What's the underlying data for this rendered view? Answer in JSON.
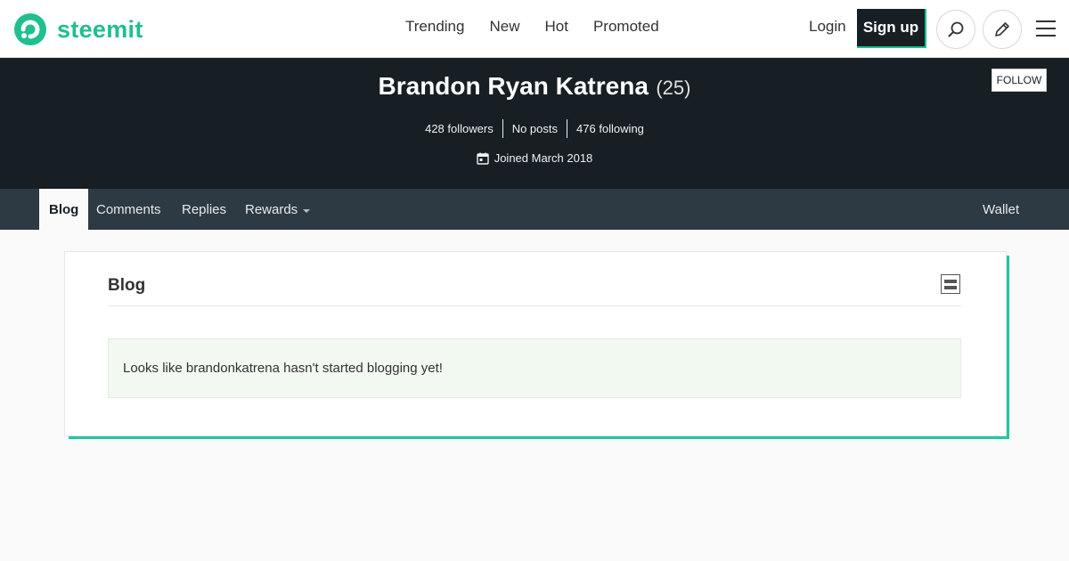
{
  "header": {
    "logo_text": "steemit",
    "nav": [
      "Trending",
      "New",
      "Hot",
      "Promoted"
    ],
    "login_label": "Login",
    "signup_label": "Sign up",
    "brand_color": "#1fbf8f"
  },
  "profile": {
    "name": "Brandon Ryan Katrena",
    "reputation": "(25)",
    "follow_label": "FOLLOW",
    "stats": [
      "428 followers",
      "No posts",
      "476 following"
    ],
    "joined": "Joined March 2018"
  },
  "tabs": {
    "items": [
      "Blog",
      "Comments",
      "Replies",
      "Rewards"
    ],
    "active": "Blog",
    "wallet_label": "Wallet"
  },
  "blog": {
    "title": "Blog",
    "empty_message": "Looks like brandonkatrena hasn't started blogging yet!"
  },
  "icons": {
    "logo": "steemit-logo-icon",
    "search": "search-icon",
    "pen": "pencil-icon",
    "menu": "hamburger-menu-icon",
    "calendar": "calendar-icon",
    "layout": "layout-toggle-icon",
    "caret": "caret-down-icon"
  }
}
